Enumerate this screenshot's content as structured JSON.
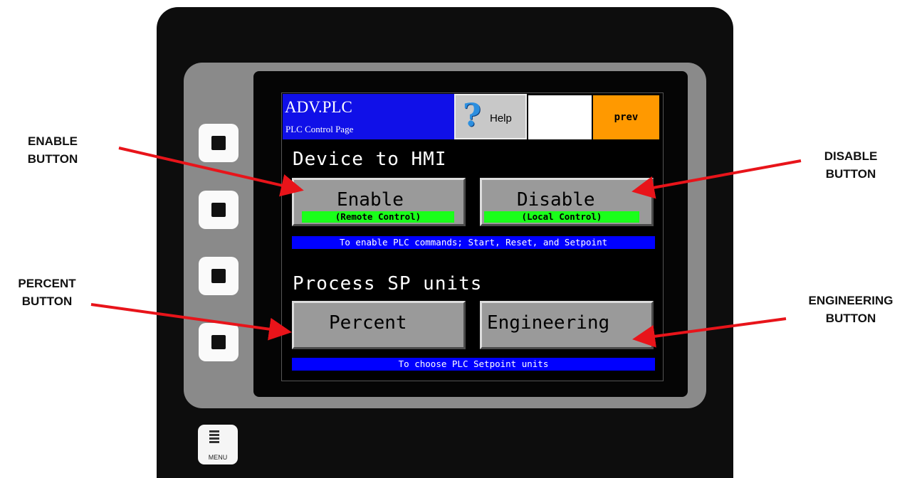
{
  "callouts": {
    "enable": [
      "ENABLE",
      "BUTTON"
    ],
    "disable": [
      "DISABLE",
      "BUTTON"
    ],
    "percent": [
      "PERCENT",
      "BUTTON"
    ],
    "engineering": [
      "ENGINEERING",
      "BUTTON"
    ]
  },
  "hmi": {
    "title": "ADV.PLC",
    "subtitle": "PLC Control Page",
    "help_label": "Help",
    "help_glyph": "?",
    "prev_label": "prev",
    "device_heading": "Device to HMI",
    "enable_label": "Enable",
    "enable_sub": "(Remote Control)",
    "disable_label": "Disable",
    "disable_sub": "(Local Control)",
    "device_info": "To enable PLC commands; Start, Reset, and Setpoint",
    "process_heading": "Process SP units",
    "percent_label": "Percent",
    "engineering_label": "Engineering",
    "process_info": "To choose PLC Setpoint units"
  },
  "menu_key_label": "MENU",
  "colors": {
    "title_bg": "#1010e8",
    "prev_bg": "#ff9900",
    "sub_label_bg": "#1aff1a",
    "info_bar_bg": "#0000ff",
    "arrow": "#e8141a"
  },
  "icons": [
    "help-question-icon",
    "menu-icon",
    "soft-key-square-icon"
  ]
}
